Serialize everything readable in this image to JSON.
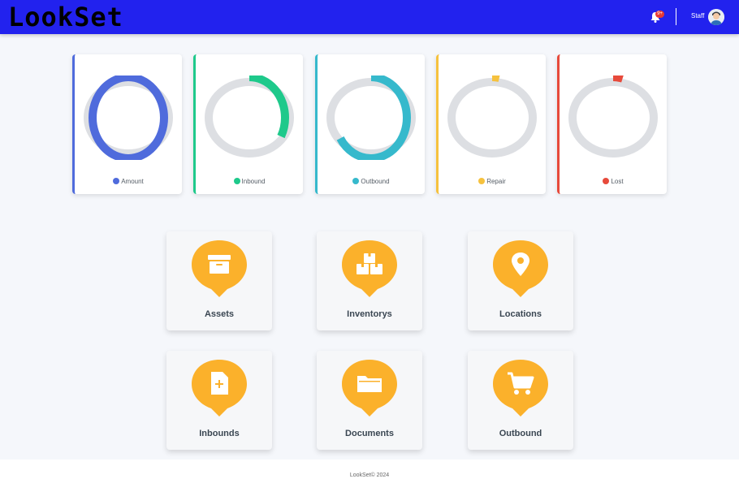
{
  "header": {
    "logo": "LookSet",
    "notification_count": "9+",
    "user_name": "Staff",
    "bg_color": "#2222ee"
  },
  "charts": {
    "cards": [
      {
        "label": "Amount",
        "color": "#4f6bdc",
        "fraction": 1.0
      },
      {
        "label": "Inbound",
        "color": "#1ec98b",
        "fraction": 0.33
      },
      {
        "label": "Outbound",
        "color": "#36b9cc",
        "fraction": 0.66
      },
      {
        "label": "Repair",
        "color": "#f6c23e",
        "fraction": 0.03
      },
      {
        "label": "Lost",
        "color": "#e74a3b",
        "fraction": 0.04
      }
    ],
    "track_color": "#dddfe3"
  },
  "chart_data": {
    "type": "pie",
    "series": [
      {
        "name": "Amount",
        "value": 1.0
      },
      {
        "name": "Inbound",
        "value": 0.33
      },
      {
        "name": "Outbound",
        "value": 0.66
      },
      {
        "name": "Repair",
        "value": 0.03
      },
      {
        "name": "Lost",
        "value": 0.04
      }
    ]
  },
  "tiles": {
    "items": [
      {
        "label": "Assets",
        "icon": "archive-box-icon"
      },
      {
        "label": "Inventorys",
        "icon": "boxes-icon"
      },
      {
        "label": "Locations",
        "icon": "map-pin-icon"
      },
      {
        "label": "Inbounds",
        "icon": "file-plus-icon"
      },
      {
        "label": "Documents",
        "icon": "folder-icon"
      },
      {
        "label": "Outbound",
        "icon": "cart-icon"
      }
    ],
    "accent_color": "#fbb12b"
  },
  "footer": {
    "text": "LookSet© 2024"
  }
}
